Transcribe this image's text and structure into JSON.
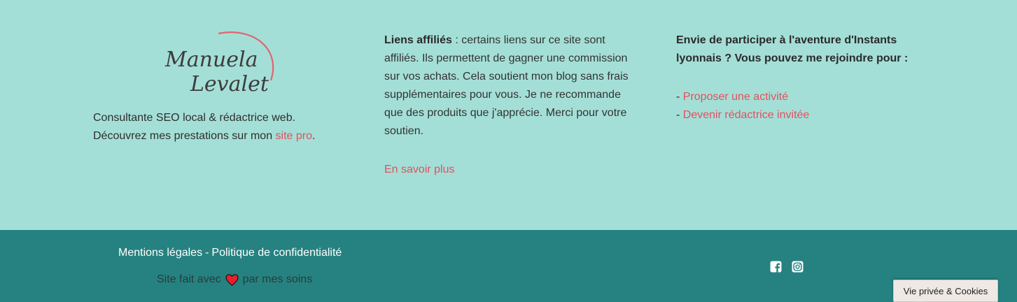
{
  "logo": {
    "line1": "Manuela",
    "line2": "Levalet"
  },
  "about": {
    "line1": "Consultante SEO local & rédactrice web.",
    "line2_prefix": "Découvrez mes prestations sur mon ",
    "line2_link": "site pro",
    "line2_suffix": "."
  },
  "affiliate": {
    "title": "Liens affiliés",
    "text": " : certains liens sur ce site sont affiliés. Ils permettent de gagner une commission sur vos achats. Cela soutient mon blog sans frais supplémentaires pour vous. Je ne recommande que des produits que j'apprécie. Merci pour votre soutien.",
    "more_link": "En savoir plus"
  },
  "join": {
    "heading": "Envie de participer à l'aventure d'Instants lyonnais ? Vous pouvez me rejoindre pour :",
    "items": [
      {
        "prefix": "- ",
        "label": "Proposer une activité"
      },
      {
        "prefix": "- ",
        "label": "Devenir rédactrice invitée"
      }
    ]
  },
  "footer": {
    "legal_link": "Mentions légales",
    "separator": "-",
    "privacy_link": "Politique de confidentialité",
    "made_prefix": "Site fait avec",
    "made_suffix": "par mes soins",
    "social_icons": [
      "facebook-icon",
      "instagram-icon"
    ]
  },
  "cookie_button": "Vie privée & Cookies",
  "colors": {
    "top_bg": "#a4dfd7",
    "bottom_bg": "#258280",
    "link": "#e0515e",
    "heart": "#e8202b"
  }
}
